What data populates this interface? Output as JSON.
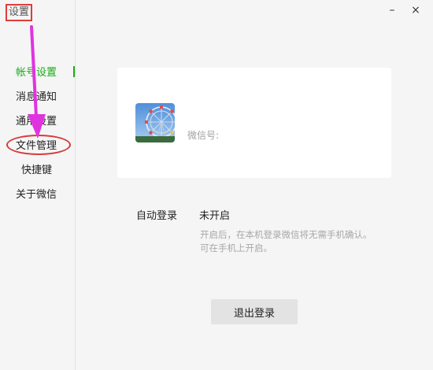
{
  "window": {
    "title": "设置",
    "minimize_glyph": "–",
    "close_glyph": "×"
  },
  "sidebar": {
    "items": [
      {
        "label": "帐号设置",
        "active": true
      },
      {
        "label": "消息通知",
        "active": false
      },
      {
        "label": "通用设置",
        "active": false
      },
      {
        "label": "文件管理",
        "active": false
      },
      {
        "label": "快捷键",
        "active": false
      },
      {
        "label": "关于微信",
        "active": false
      }
    ]
  },
  "account": {
    "avatar": "ferris-wheel-photo",
    "wechat_id_label": "微信号:",
    "wechat_id_value": ""
  },
  "auto_login": {
    "label": "自动登录",
    "value": "未开启",
    "description_line1": "开启后，在本机登录微信将无需手机确认。",
    "description_line2": "可在手机上开启。"
  },
  "logout_button": "退出登录",
  "annotations": {
    "highlight_color": "#e23b3b",
    "arrow_color": "#e033e0"
  },
  "colors": {
    "accent_green": "#1aad19",
    "background": "#f5f5f5",
    "card": "#ffffff"
  }
}
